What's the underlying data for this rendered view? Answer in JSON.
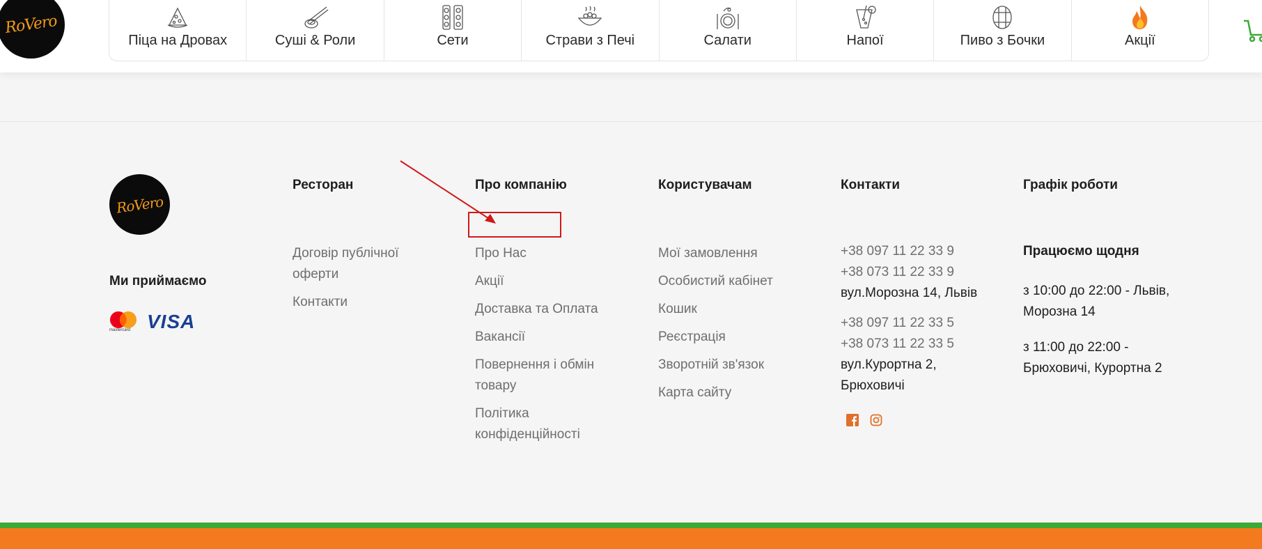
{
  "header": {
    "logo_text": "RoVero",
    "nav": [
      {
        "label": "Піца на Дровах",
        "icon": "pizza-icon"
      },
      {
        "label": "Суші & Роли",
        "icon": "sushi-icon"
      },
      {
        "label": "Сети",
        "icon": "sets-icon"
      },
      {
        "label": "Страви з Печі",
        "icon": "bowl-icon"
      },
      {
        "label": "Салати",
        "icon": "salad-icon"
      },
      {
        "label": "Напої",
        "icon": "drink-icon"
      },
      {
        "label": "Пиво з Бочки",
        "icon": "barrel-icon"
      },
      {
        "label": "Акції",
        "icon": "fire-icon"
      }
    ],
    "cart_icon": "cart-icon"
  },
  "footer": {
    "logo_text": "RoVero",
    "accept_title": "Ми приймаємо",
    "payment": {
      "mastercard_caption": "mastercard",
      "visa": "VISA"
    },
    "restaurant": {
      "title": "Ресторан",
      "links": [
        "Договір публічної оферти",
        "Контакти"
      ]
    },
    "company": {
      "title": "Про компанію",
      "links": [
        "Про Нас",
        "Акції",
        "Доставка та Оплата",
        "Вакансії",
        "Повернення і обмін товару",
        "Політика конфіденційності"
      ]
    },
    "users": {
      "title": "Користувачам",
      "links": [
        "Мої замовлення",
        "Особистий кабінет",
        "Кошик",
        "Реєстрація",
        "Зворотній зв'язок",
        "Карта сайту"
      ]
    },
    "contacts": {
      "title": "Контакти",
      "lviv_phone1": "+38 097 11 22 33 9",
      "lviv_phone2": "+38 073 11 22 33 9",
      "lviv_address": "вул.Морозна 14, Львів",
      "br_phone1": "+38 097 11 22 33 5",
      "br_phone2": "+38 073 11 22 33 5",
      "br_address": "вул.Курортна 2, Брюховичі"
    },
    "schedule": {
      "title": "Графік роботи",
      "subtitle": "Працюємо щодня",
      "line1": "з 10:00 до 22:00 - Львів, Морозна 14",
      "line2": "з 11:00 до 22:00 - Брюховичі, Курортна 2"
    },
    "colors": {
      "green": "#3aaa35",
      "orange": "#f37a1f",
      "logo_orange": "#f29a1a"
    }
  }
}
